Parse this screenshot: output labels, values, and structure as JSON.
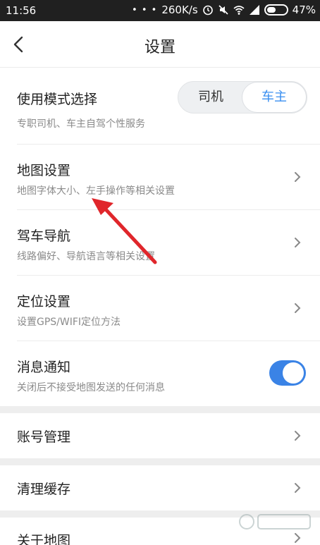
{
  "status_bar": {
    "time": "11:56",
    "dots": "• • •",
    "speed": "260K/s",
    "battery": "47%"
  },
  "header": {
    "title": "设置"
  },
  "mode": {
    "label": "使用模式选择",
    "description": "专职司机、车主自驾个性服务",
    "options": [
      "司机",
      "车主"
    ],
    "selected": "车主"
  },
  "items": [
    {
      "title": "地图设置",
      "subtitle": "地图字体大小、左手操作等相关设置"
    },
    {
      "title": "驾车导航",
      "subtitle": "线路偏好、导航语言等相关设置"
    },
    {
      "title": "定位设置",
      "subtitle": "设置GPS/WIFI定位方法"
    },
    {
      "title": "消息通知",
      "subtitle": "关闭后不接受地图发送的任何消息",
      "toggle_on": true
    }
  ],
  "sections": [
    {
      "title": "账号管理"
    },
    {
      "title": "清理缓存"
    },
    {
      "title": "关于地图"
    }
  ],
  "colors": {
    "accent": "#3a8ff0",
    "toggle": "#3a83e6",
    "arrow": "#e0262b"
  }
}
